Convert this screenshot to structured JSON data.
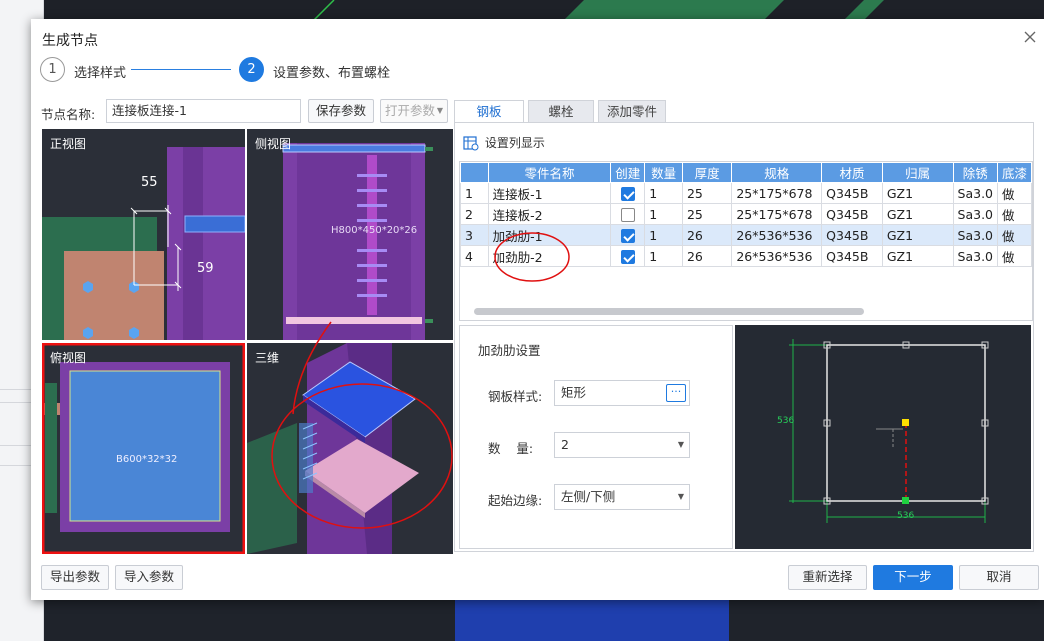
{
  "dialog": {
    "title": "生成节点",
    "close_icon": "close-icon"
  },
  "steps": [
    {
      "number": "1",
      "label": "选择样式"
    },
    {
      "number": "2",
      "label": "设置参数、布置螺栓"
    }
  ],
  "node": {
    "name_label": "节点名称:",
    "name_value": "连接板连接-1",
    "save_params": "保存参数",
    "open_params": "打开参数"
  },
  "views": {
    "front": {
      "label": "正视图",
      "dim_h": "55",
      "dim_v": "59"
    },
    "side": {
      "label": "侧视图",
      "section": "H800*450*20*26"
    },
    "top": {
      "label": "俯视图",
      "plate": "B600*32*32"
    },
    "three_d": {
      "label": "三维"
    }
  },
  "tabs": [
    "钢板",
    "螺栓",
    "添加零件"
  ],
  "column_settings": "设置列显示",
  "table": {
    "columns": [
      "",
      "零件名称",
      "创建",
      "数量",
      "厚度",
      "规格",
      "材质",
      "归属",
      "除锈",
      "底漆"
    ],
    "rows": [
      {
        "idx": "1",
        "name": "连接板-1",
        "create": true,
        "qty": "1",
        "thick": "25",
        "spec": "25*175*678",
        "mat": "Q345B",
        "belong": "GZ1",
        "rust": "Sa3.0",
        "paint": "做"
      },
      {
        "idx": "2",
        "name": "连接板-2",
        "create": false,
        "qty": "1",
        "thick": "25",
        "spec": "25*175*678",
        "mat": "Q345B",
        "belong": "GZ1",
        "rust": "Sa3.0",
        "paint": "做"
      },
      {
        "idx": "3",
        "name": "加劲肋-1",
        "create": true,
        "qty": "1",
        "thick": "26",
        "spec": "26*536*536",
        "mat": "Q345B",
        "belong": "GZ1",
        "rust": "Sa3.0",
        "paint": "做"
      },
      {
        "idx": "4",
        "name": "加劲肋-2",
        "create": true,
        "qty": "1",
        "thick": "26",
        "spec": "26*536*536",
        "mat": "Q345B",
        "belong": "GZ1",
        "rust": "Sa3.0",
        "paint": "做"
      }
    ]
  },
  "stiffener": {
    "title": "加劲肋设置",
    "style_label": "钢板样式:",
    "style_value": "矩形",
    "qty_label": "数    量:",
    "qty_value": "2",
    "edge_label": "起始边缘:",
    "edge_value": "左侧/下侧",
    "preview_dim_v": "536",
    "preview_dim_h": "536"
  },
  "footer": {
    "export": "导出参数",
    "import": "导入参数",
    "reselect": "重新选择",
    "next": "下一步",
    "cancel": "取消"
  },
  "colors": {
    "primary": "#1f7ae0",
    "header_blue": "#5b9be3",
    "annotation_red": "#e01010",
    "steel_purple": "#7b3fa6"
  }
}
